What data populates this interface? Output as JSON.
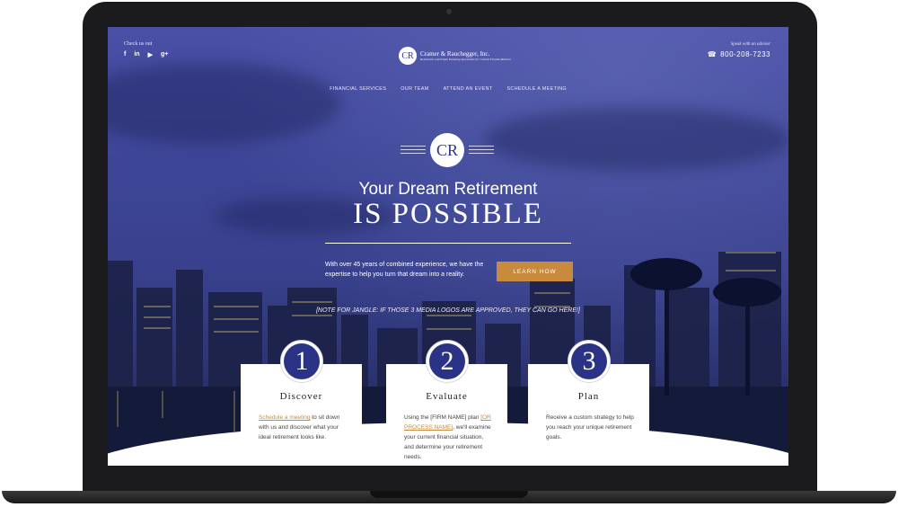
{
  "header": {
    "check_us_out": "Check us out",
    "socials": [
      "f",
      "in",
      "▶",
      "g+"
    ],
    "logo_monogram": "CR",
    "logo_name": "Cramer & Rauchegger, Inc.",
    "logo_tagline": "Retirement and Estate Planning Specialists for Central Florida Retirees",
    "advisor_label": "Speak with an advisor",
    "phone": "800-208-7233"
  },
  "nav": [
    "FINANCIAL SERVICES",
    "OUR TEAM",
    "ATTEND AN EVENT",
    "SCHEDULE A MEETING"
  ],
  "hero": {
    "monogram": "CR",
    "line1": "Your Dream Retirement",
    "line2": "IS POSSIBLE",
    "intro": "With over 45 years of combined experience, we have the expertise to help you turn that dream into a reality.",
    "cta": "LEARN HOW",
    "note": "[NOTE FOR JANGLE: IF THOSE 3 MEDIA LOGOS ARE APPROVED, THEY CAN GO HERE!]"
  },
  "steps": [
    {
      "num": "1",
      "title": "Discover",
      "link": "Schedule a meeting",
      "body": " to sit down with us and discover what your ideal retirement looks like."
    },
    {
      "num": "2",
      "title": "Evaluate",
      "pre": "Using the [FIRM NAME] plan ",
      "link": "[OR PROCESS NAME]",
      "body": ", we'll examine your current financial situation, and determine your retirement needs."
    },
    {
      "num": "3",
      "title": "Plan",
      "body": "Receive a custom strategy to help you reach your unique retirement goals."
    }
  ],
  "colors": {
    "navy": "#2b3386",
    "accent": "#c88a3c"
  }
}
